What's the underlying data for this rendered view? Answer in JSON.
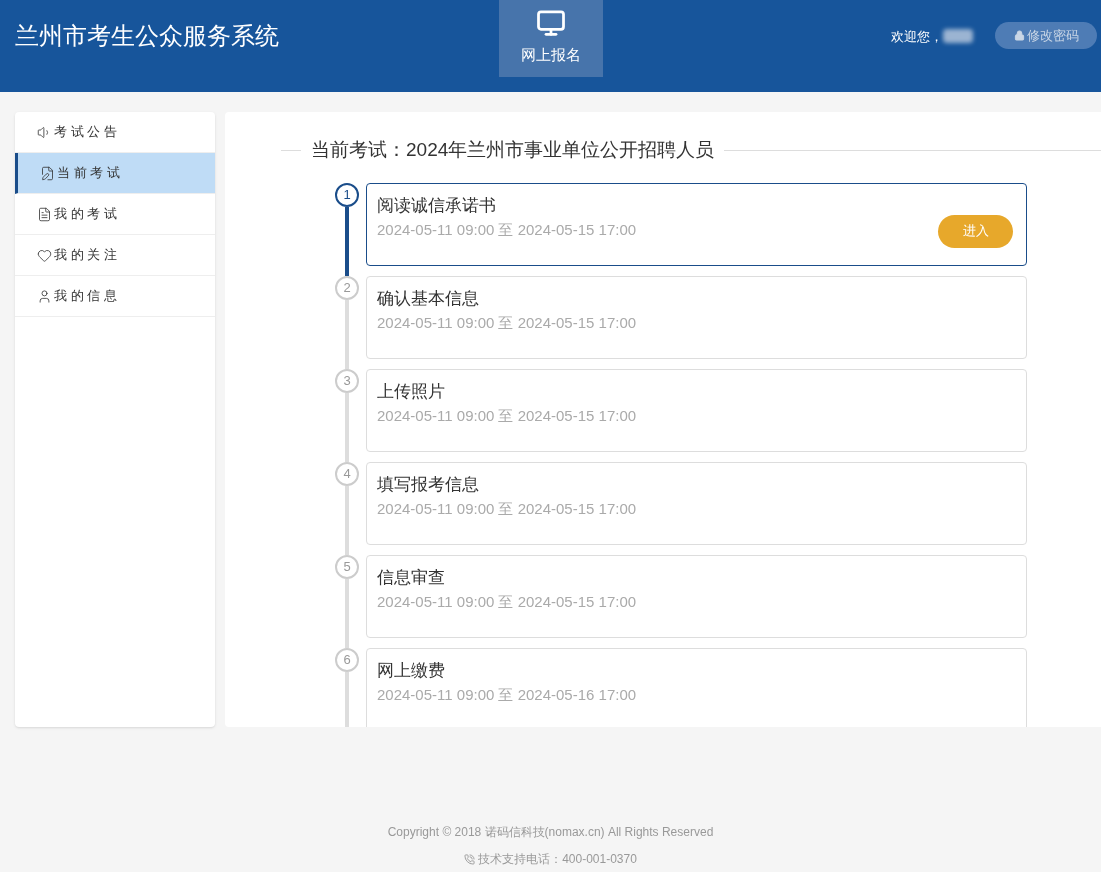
{
  "header": {
    "title": "兰州市考生公众服务系统",
    "nav": [
      {
        "label": "网上报名",
        "selected": true
      }
    ],
    "welcome": "欢迎您，",
    "change_password": "修改密码"
  },
  "sidebar": {
    "items": [
      {
        "label": "考 试 公 告",
        "selected": false
      },
      {
        "label": "当 前 考 试",
        "selected": true
      },
      {
        "label": "我 的 考 试",
        "selected": false
      },
      {
        "label": "我 的 关 注",
        "selected": false
      },
      {
        "label": "我 的 信 息",
        "selected": false
      }
    ]
  },
  "exam": {
    "title": "当前考试：2024年兰州市事业单位公开招聘人员",
    "steps": [
      {
        "number": "1",
        "name": "阅读诚信承诺书",
        "period": "2024-05-11 09:00 至 2024-05-15 17:00",
        "selected": true,
        "button": "进入"
      },
      {
        "number": "2",
        "name": "确认基本信息",
        "period": "2024-05-11 09:00 至 2024-05-15 17:00",
        "selected": false
      },
      {
        "number": "3",
        "name": "上传照片",
        "period": "2024-05-11 09:00 至 2024-05-15 17:00",
        "selected": false
      },
      {
        "number": "4",
        "name": "填写报考信息",
        "period": "2024-05-11 09:00 至 2024-05-15 17:00",
        "selected": false
      },
      {
        "number": "5",
        "name": "信息审查",
        "period": "2024-05-11 09:00 至 2024-05-15 17:00",
        "selected": false
      },
      {
        "number": "6",
        "name": "网上缴费",
        "period": "2024-05-11 09:00 至 2024-05-16 17:00",
        "selected": false
      }
    ]
  },
  "footer": {
    "copyright": "Copyright © 2018 诺码信科技(nomax.cn) All Rights Reserved",
    "support": "技术支持电话：400-001-0370"
  }
}
